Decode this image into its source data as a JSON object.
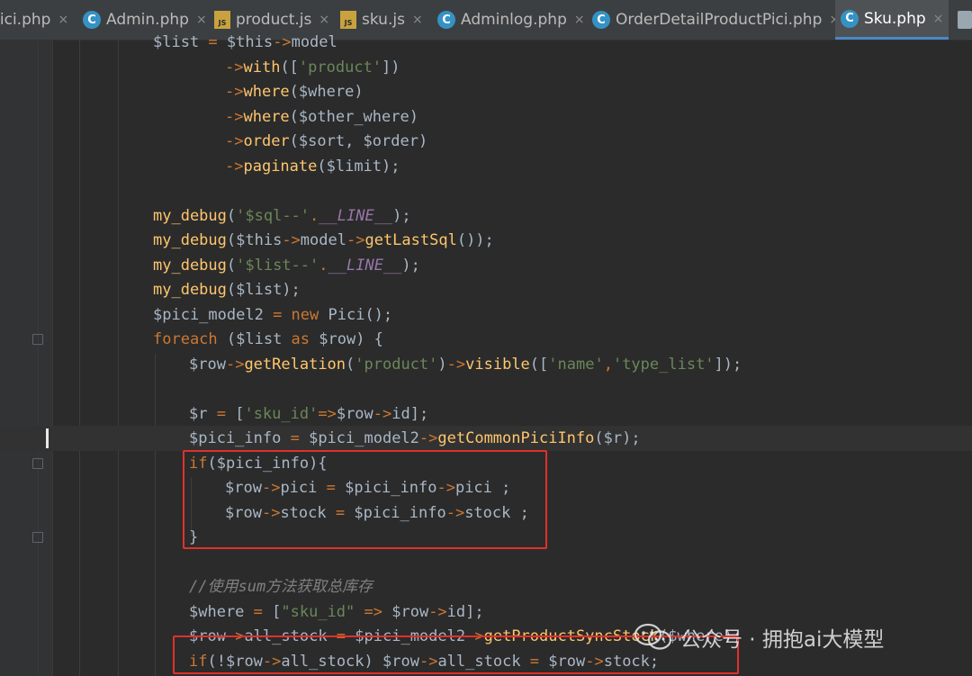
{
  "tabs": [
    {
      "label": "Pici.php",
      "icon": "php-class-icon",
      "active": false
    },
    {
      "label": "Admin.php",
      "icon": "php-class-icon",
      "active": false
    },
    {
      "label": "product.js",
      "icon": "js-file-icon",
      "active": false
    },
    {
      "label": "sku.js",
      "icon": "js-file-icon",
      "active": false
    },
    {
      "label": "Adminlog.php",
      "icon": "php-class-icon",
      "active": false
    },
    {
      "label": "OrderDetailProductPici.php",
      "icon": "php-class-icon",
      "active": false
    },
    {
      "label": "Sku.php",
      "icon": "php-class-icon",
      "active": true
    }
  ],
  "code": [
    {
      "t": [
        [
          "$list ",
          "v"
        ],
        [
          "= ",
          "op"
        ],
        [
          "$this",
          "v"
        ],
        [
          "->",
          "op"
        ],
        [
          "model",
          "v"
        ]
      ]
    },
    {
      "t": [
        [
          "->",
          "op"
        ],
        [
          "with",
          "fn"
        ],
        [
          "([",
          "v"
        ],
        [
          "'product'",
          "st"
        ],
        [
          "])",
          "v"
        ]
      ]
    },
    {
      "t": [
        [
          "->",
          "op"
        ],
        [
          "where",
          "fn"
        ],
        [
          "($where)",
          "v"
        ]
      ]
    },
    {
      "t": [
        [
          "->",
          "op"
        ],
        [
          "where",
          "fn"
        ],
        [
          "($other_where)",
          "v"
        ]
      ]
    },
    {
      "t": [
        [
          "->",
          "op"
        ],
        [
          "order",
          "fn"
        ],
        [
          "($sort, $order)",
          "v"
        ]
      ]
    },
    {
      "t": [
        [
          "->",
          "op"
        ],
        [
          "paginate",
          "fn"
        ],
        [
          "($limit);",
          "v"
        ]
      ]
    },
    {
      "t": []
    },
    {
      "t": [
        [
          "my_debug",
          "fn"
        ],
        [
          "(",
          "v"
        ],
        [
          "'$sql--'",
          "st"
        ],
        [
          ".",
          "op"
        ],
        [
          "__LINE__",
          "cn"
        ],
        [
          ");",
          "v"
        ]
      ]
    },
    {
      "t": [
        [
          "my_debug",
          "fn"
        ],
        [
          "($this",
          "v"
        ],
        [
          "->",
          "op"
        ],
        [
          "model",
          "v"
        ],
        [
          "->",
          "op"
        ],
        [
          "getLastSql",
          "fn"
        ],
        [
          "());",
          "v"
        ]
      ]
    },
    {
      "t": [
        [
          "my_debug",
          "fn"
        ],
        [
          "(",
          "v"
        ],
        [
          "'$list--'",
          "st"
        ],
        [
          ".",
          "op"
        ],
        [
          "__LINE__",
          "cn"
        ],
        [
          ");",
          "v"
        ]
      ]
    },
    {
      "t": [
        [
          "my_debug",
          "fn"
        ],
        [
          "($list);",
          "v"
        ]
      ]
    },
    {
      "t": [
        [
          "$pici_model2 ",
          "v"
        ],
        [
          "= ",
          "op"
        ],
        [
          "new ",
          "kw"
        ],
        [
          "Pici();",
          "v"
        ]
      ]
    },
    {
      "t": [
        [
          "foreach ",
          "kw"
        ],
        [
          "($list ",
          "v"
        ],
        [
          "as ",
          "kw"
        ],
        [
          "$row) {",
          "v"
        ]
      ]
    },
    {
      "t": [
        [
          "$row",
          "v"
        ],
        [
          "->",
          "op"
        ],
        [
          "getRelation",
          "fn"
        ],
        [
          "(",
          "v"
        ],
        [
          "'product'",
          "st"
        ],
        [
          ")",
          "v"
        ],
        [
          "->",
          "op"
        ],
        [
          "visible",
          "fn"
        ],
        [
          "([",
          "v"
        ],
        [
          "'name'",
          "st"
        ],
        [
          ",",
          "op"
        ],
        [
          "'type_list'",
          "st"
        ],
        [
          "]);",
          "v"
        ]
      ]
    },
    {
      "t": []
    },
    {
      "t": [
        [
          "$r ",
          "v"
        ],
        [
          "= ",
          "op"
        ],
        [
          "[",
          "v"
        ],
        [
          "'sku_id'",
          "st"
        ],
        [
          "=>",
          "op"
        ],
        [
          "$row",
          "v"
        ],
        [
          "->",
          "op"
        ],
        [
          "id];",
          "v"
        ]
      ]
    },
    {
      "t": [
        [
          "$pici_info ",
          "v"
        ],
        [
          "= ",
          "op"
        ],
        [
          "$pici_model2",
          "v"
        ],
        [
          "->",
          "op"
        ],
        [
          "getCommonPiciInfo",
          "fn"
        ],
        [
          "($r);",
          "v"
        ]
      ]
    },
    {
      "t": [
        [
          "if",
          "kw"
        ],
        [
          "($pici_info){",
          "v"
        ]
      ]
    },
    {
      "t": [
        [
          "$row",
          "v"
        ],
        [
          "->",
          "op"
        ],
        [
          "pici ",
          "v"
        ],
        [
          "= ",
          "op"
        ],
        [
          "$pici_info",
          "v"
        ],
        [
          "->",
          "op"
        ],
        [
          "pici ;",
          "v"
        ]
      ]
    },
    {
      "t": [
        [
          "$row",
          "v"
        ],
        [
          "->",
          "op"
        ],
        [
          "stock ",
          "v"
        ],
        [
          "= ",
          "op"
        ],
        [
          "$pici_info",
          "v"
        ],
        [
          "->",
          "op"
        ],
        [
          "stock ;",
          "v"
        ]
      ]
    },
    {
      "t": [
        [
          "}",
          "v"
        ]
      ]
    },
    {
      "t": []
    },
    {
      "t": [
        [
          "//使用sum方法获取总库存",
          "cm"
        ]
      ]
    },
    {
      "t": [
        [
          "$where ",
          "v"
        ],
        [
          "= ",
          "op"
        ],
        [
          "[",
          "v"
        ],
        [
          "\"sku_id\" ",
          "st"
        ],
        [
          "=> ",
          "op"
        ],
        [
          "$row",
          "v"
        ],
        [
          "->",
          "op"
        ],
        [
          "id];",
          "v"
        ]
      ]
    },
    {
      "t": [
        [
          "$row",
          "v"
        ],
        [
          "->",
          "op"
        ],
        [
          "all_stock ",
          "v"
        ],
        [
          "= ",
          "op"
        ],
        [
          "$pici_model2",
          "v"
        ],
        [
          "->",
          "op"
        ],
        [
          "getProductSyncStock",
          "fn"
        ],
        [
          "($where);",
          "v"
        ]
      ]
    },
    {
      "t": [
        [
          "if",
          "kw"
        ],
        [
          "(!",
          "v"
        ],
        [
          "$row",
          "v"
        ],
        [
          "->",
          "op"
        ],
        [
          "all_stock) ",
          "v"
        ],
        [
          "$row",
          "v"
        ],
        [
          "->",
          "op"
        ],
        [
          "all_stock ",
          "v"
        ],
        [
          "= ",
          "op"
        ],
        [
          "$row",
          "v"
        ],
        [
          "->",
          "op"
        ],
        [
          "stock;",
          "v"
        ]
      ]
    }
  ],
  "watermark": {
    "text": "公众号 · 拥抱ai大模型",
    "icon": "wechat-icon"
  },
  "colors": {
    "editor_bg": "#2b2b2b",
    "gutter_bg": "#313335",
    "tabbar_bg": "#3c3f41",
    "active_tab_underline": "#4a88c7",
    "keyword": "#cc7832",
    "function": "#ffc66d",
    "string": "#6a8759",
    "constant": "#9876aa",
    "comment": "#808080",
    "highlight_box": "#e2302c"
  }
}
